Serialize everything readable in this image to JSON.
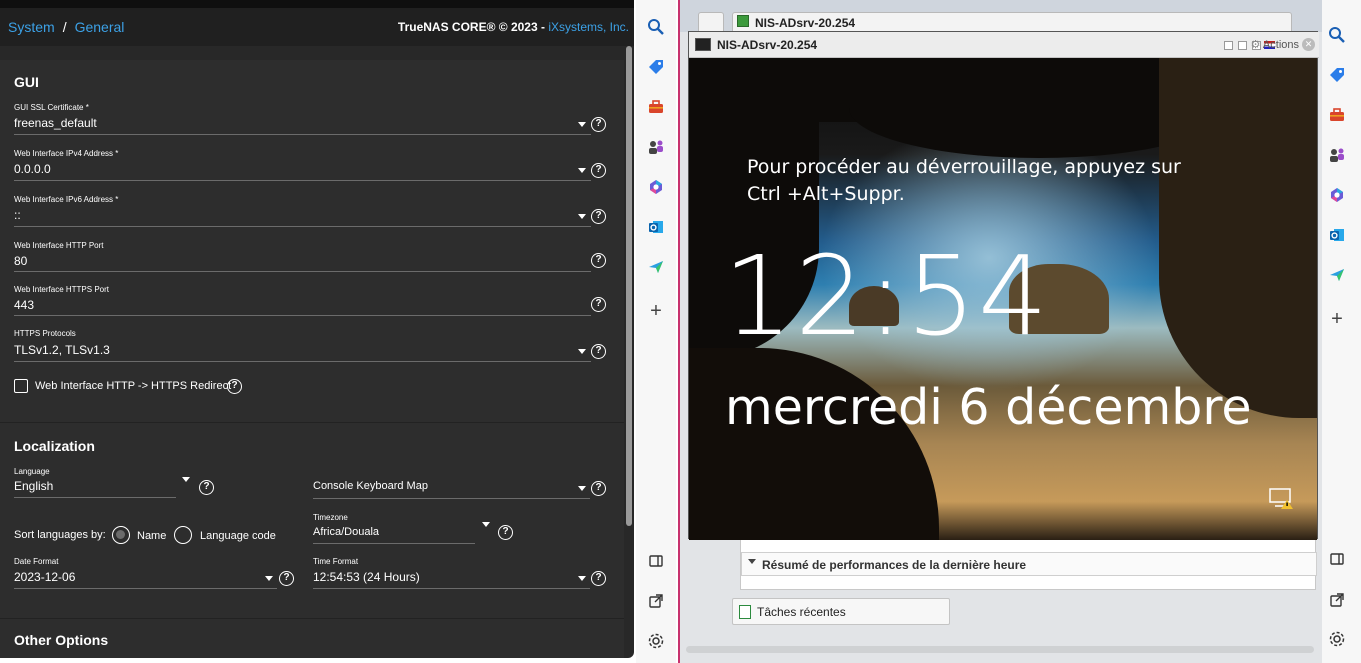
{
  "truenas": {
    "breadcrumb": {
      "system": "System",
      "sep": "/",
      "general": "General"
    },
    "copyright": {
      "text": "TrueNAS CORE® © 2023 - ",
      "link": "iXsystems, Inc."
    },
    "gui": {
      "title": "GUI",
      "ssl_cert": {
        "label": "GUI SSL Certificate *",
        "value": "freenas_default"
      },
      "ipv4": {
        "label": "Web Interface IPv4 Address *",
        "value": "0.0.0.0"
      },
      "ipv6": {
        "label": "Web Interface IPv6 Address *",
        "value": "::"
      },
      "http_port": {
        "label": "Web Interface HTTP Port",
        "value": "80"
      },
      "https_port": {
        "label": "Web Interface HTTPS Port",
        "value": "443"
      },
      "https_protocols": {
        "label": "HTTPS Protocols",
        "value": "TLSv1.2, TLSv1.3"
      },
      "redirect": {
        "label": "Web Interface HTTP -> HTTPS Redirect",
        "checked": false
      }
    },
    "localization": {
      "title": "Localization",
      "language": {
        "label": "Language",
        "value": "English"
      },
      "keyboard_map": {
        "label": "Console Keyboard Map"
      },
      "sort_by": {
        "label": "Sort languages by:",
        "options": [
          "Name",
          "Language code"
        ],
        "selected": "Name"
      },
      "timezone": {
        "label": "Timezone",
        "value": "Africa/Douala"
      },
      "date_format": {
        "label": "Date Format",
        "value": "2023-12-06"
      },
      "time_format": {
        "label": "Time Format",
        "value": "12:54:53 (24 Hours)"
      }
    },
    "other_options": {
      "title": "Other Options"
    }
  },
  "sidebar_left": {
    "icons": [
      "search-icon",
      "tag-icon",
      "toolbox-icon",
      "games-icon",
      "copilot-icon",
      "outlook-icon",
      "send-icon",
      "add-icon",
      "split-view-icon",
      "external-link-icon",
      "settings-icon"
    ]
  },
  "vm": {
    "tab_title": "NIS-ADsrv-20.254",
    "window_title": "NIS-ADsrv-20.254",
    "actions_label": "Actions",
    "lock_message": "Pour procéder au déverrouillage, appuyez sur Ctrl +Alt+Suppr.",
    "time": "12:54",
    "date": "mercredi 6 décembre",
    "perf_title": "Résumé de performances de la dernière heure",
    "recent_tasks": "Tâches récentes"
  },
  "colors": {
    "accent_blue": "#3ca1e6",
    "panel_bg": "#2d2d2d",
    "vm_border": "#c8326e"
  }
}
